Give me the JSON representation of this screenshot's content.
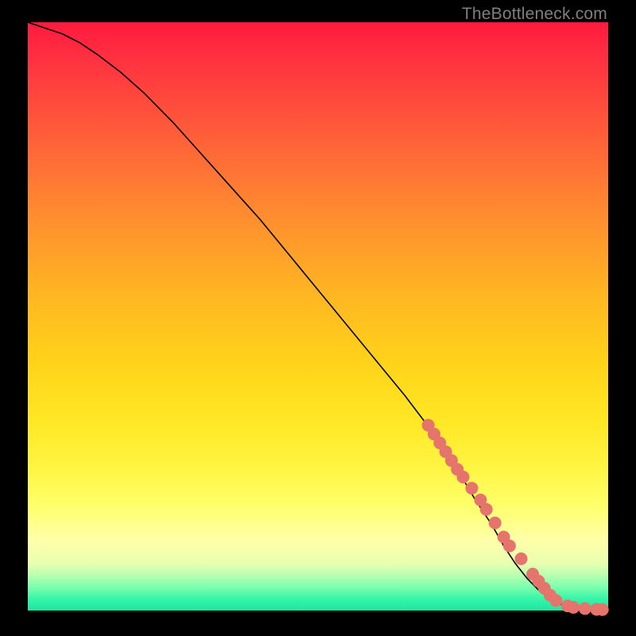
{
  "watermark": "TheBottleneck.com",
  "colors": {
    "marker": "#e5746d",
    "curve": "#000000",
    "frame": "#000000"
  },
  "chart_data": {
    "type": "line",
    "title": "",
    "xlabel": "",
    "ylabel": "",
    "xlim": [
      0,
      100
    ],
    "ylim": [
      0,
      100
    ],
    "grid": false,
    "legend": false,
    "series": [
      {
        "name": "bottleneck-curve",
        "x": [
          0,
          3,
          6,
          9,
          12,
          16,
          20,
          25,
          30,
          35,
          40,
          45,
          50,
          55,
          60,
          65,
          70,
          74,
          77,
          80,
          82,
          84,
          86,
          88,
          90,
          92,
          94,
          96,
          98,
          100
        ],
        "y": [
          100,
          99,
          98,
          96.5,
          94.5,
          91.5,
          88,
          83,
          77.5,
          72,
          66.5,
          60.5,
          54.5,
          48.5,
          42.5,
          36.5,
          30,
          24,
          19,
          14.5,
          11,
          8,
          5.5,
          3.5,
          2,
          1,
          0.5,
          0.3,
          0.2,
          0.15
        ]
      }
    ],
    "markers": {
      "name": "highlighted-points",
      "x": [
        69,
        70,
        71,
        72,
        73,
        74,
        75,
        76.5,
        78,
        79,
        80.5,
        82,
        83,
        85,
        87,
        88,
        89,
        90,
        91,
        93,
        94,
        96,
        98,
        99
      ],
      "y": [
        31.5,
        30,
        28.5,
        27,
        25.5,
        24,
        22.7,
        20.8,
        18.8,
        17.2,
        14.9,
        12.5,
        11,
        8.8,
        6.2,
        5,
        3.8,
        2.6,
        1.7,
        0.8,
        0.55,
        0.35,
        0.2,
        0.17
      ]
    }
  }
}
